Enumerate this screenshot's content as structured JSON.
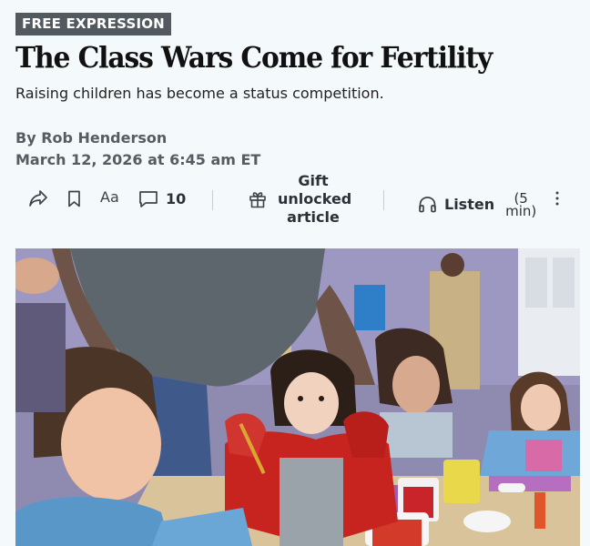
{
  "article": {
    "section_tag": "FREE EXPRESSION",
    "headline": "The Class Wars Come for Fertility",
    "dek": "Raising children has become a status competition.",
    "byline": "By Rob Henderson",
    "date": "March 12, 2026 at 6:45 am ET"
  },
  "toolbar": {
    "share_icon": "share-arrow",
    "bookmark_icon": "bookmark",
    "text_size_label": "Aa",
    "comment_icon": "speech-bubble",
    "comments_count": "10",
    "gift_icon": "gift-box",
    "gift_label": "Gift\nunlocked\narticle",
    "listen_icon": "headphones",
    "listen_label": "Listen",
    "listen_duration": "(5\nmin)",
    "more_icon": "vertical-ellipsis"
  },
  "image": {
    "alt_subject": "young children painting at a table in a classroom"
  }
}
